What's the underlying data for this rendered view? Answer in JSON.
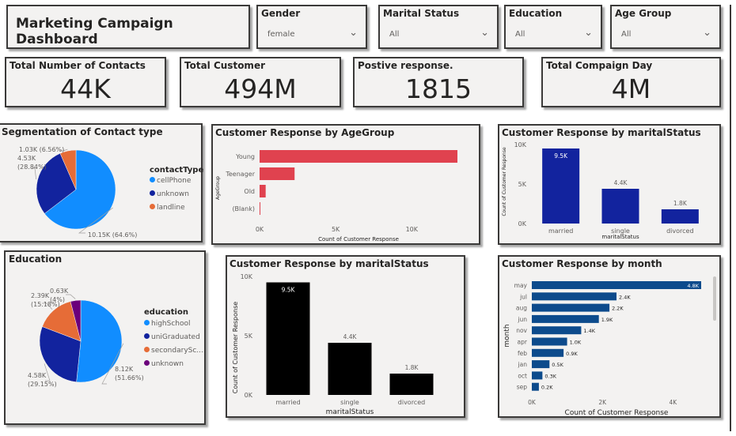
{
  "header": {
    "title": "Marketing Campaign Dashboard"
  },
  "slicers": [
    {
      "label": "Gender",
      "value": "female"
    },
    {
      "label": "Marital Status",
      "value": "All"
    },
    {
      "label": "Education",
      "value": "All"
    },
    {
      "label": "Age Group",
      "value": "All"
    }
  ],
  "kpis": [
    {
      "label": "Total Number of Contacts",
      "value": "44K"
    },
    {
      "label": "Total Customer",
      "value": "494M"
    },
    {
      "label": "Postive response.",
      "value": "1815"
    },
    {
      "label": "Total Compaign Day",
      "value": "4M"
    }
  ],
  "icons": {
    "chevron": "chevron-down-icon"
  },
  "colors": {
    "pie_blue": "#118dff",
    "pie_navy": "#12239e",
    "pie_orange": "#e66c37",
    "pie_purple": "#6b007b",
    "bar_red": "#e0424f",
    "bar_navy": "#12239e",
    "bar_black": "#000000",
    "bar_month": "#0d4b8c"
  },
  "chart_data": [
    {
      "type": "pie",
      "title": "Segmentation of Contact type",
      "legend_title": "contactType",
      "categories": [
        "cellPhone",
        "unknown",
        "landline"
      ],
      "values": [
        10150,
        4530,
        1030
      ],
      "labels": [
        "10.15K (64.6%)",
        "4.53K (28.84%)",
        "1.03K (6.56%)"
      ],
      "label_lines": [
        [
          "10.15K (64.6%)"
        ],
        [
          "4.53K",
          "(28.84%)"
        ],
        [
          "1.03K (6.56%)"
        ]
      ],
      "colors": [
        "#118dff",
        "#12239e",
        "#e66c37"
      ],
      "legend_position": "right"
    },
    {
      "type": "bar",
      "orientation": "horizontal",
      "title": "Customer Response by AgeGroup",
      "categories": [
        "Young",
        "Teenager",
        "Old",
        "(Blank)"
      ],
      "values": [
        13000,
        2300,
        400,
        50
      ],
      "xlabel": "Count of Customer Response",
      "ylabel": "AgeGroup",
      "xlim": [
        0,
        13000
      ],
      "xticks": [
        "0K",
        "5K",
        "10K"
      ],
      "color": "#e0424f"
    },
    {
      "type": "bar",
      "title": "Customer Response by maritalStatus",
      "categories": [
        "married",
        "single",
        "divorced"
      ],
      "values": [
        9500,
        4400,
        1800
      ],
      "data_labels": [
        "9.5K",
        "4.4K",
        "1.8K"
      ],
      "xlabel": "maritalStatus",
      "ylabel": "Count of Customer Response",
      "ylim": [
        0,
        10000
      ],
      "yticks": [
        "0K",
        "5K",
        "10K"
      ],
      "color": "#12239e"
    },
    {
      "type": "pie",
      "title": "Education",
      "legend_title": "education",
      "categories": [
        "highSchool",
        "uniGraduated",
        "secondarySc...",
        "unknown"
      ],
      "values": [
        8120,
        4580,
        2390,
        630
      ],
      "labels": [
        "8.12K (51.66%)",
        "4.58K (29.15%)",
        "2.39K (15.18%)",
        "0.63K (4%)"
      ],
      "label_lines": [
        [
          "8.12K",
          "(51.66%)"
        ],
        [
          "4.58K",
          "(29.15%)"
        ],
        [
          "2.39K",
          "(15.18%)"
        ],
        [
          "0.63K",
          "(4%)"
        ]
      ],
      "colors": [
        "#118dff",
        "#12239e",
        "#e66c37",
        "#6b007b"
      ],
      "legend_position": "right"
    },
    {
      "type": "bar",
      "title": "Customer Response by maritalStatus",
      "categories": [
        "married",
        "single",
        "divorced"
      ],
      "values": [
        9500,
        4400,
        1800
      ],
      "data_labels": [
        "9.5K",
        "4.4K",
        "1.8K"
      ],
      "xlabel": "maritalStatus",
      "ylabel": "Count of Customer Response",
      "ylim": [
        0,
        10000
      ],
      "yticks": [
        "0K",
        "5K",
        "10K"
      ],
      "color": "#000000"
    },
    {
      "type": "bar",
      "orientation": "horizontal",
      "title": "Customer Response by month",
      "categories": [
        "may",
        "jul",
        "aug",
        "jun",
        "nov",
        "apr",
        "feb",
        "jan",
        "oct",
        "sep"
      ],
      "values": [
        4800,
        2400,
        2200,
        1900,
        1400,
        1000,
        900,
        500,
        300,
        200
      ],
      "data_labels": [
        "4.8K",
        "2.4K",
        "2.2K",
        "1.9K",
        "1.4K",
        "1.0K",
        "0.9K",
        "0.5K",
        "0.3K",
        "0.2K"
      ],
      "xlabel": "Count of Customer Response",
      "ylabel": "month",
      "xlim": [
        0,
        4800
      ],
      "xticks": [
        "0K",
        "2K",
        "4K"
      ],
      "color": "#0d4b8c"
    }
  ]
}
